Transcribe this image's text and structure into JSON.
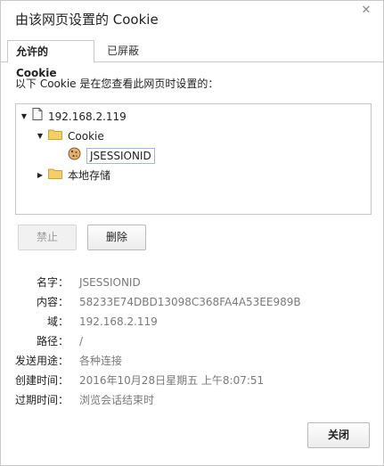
{
  "dialog": {
    "title": "由该网页设置的 Cookie",
    "close_glyph": "✕"
  },
  "tabs": [
    {
      "label": "允许的 Cookie"
    },
    {
      "label": "已屏蔽"
    }
  ],
  "intro": "以下 Cookie 是在您查看此网页时设置的：",
  "tree": {
    "host": "192.168.2.119",
    "folder_cookie": "Cookie",
    "cookie_item": "JSESSIONID",
    "folder_storage": "本地存储"
  },
  "buttons": {
    "block": "禁止",
    "delete": "删除",
    "close": "关闭"
  },
  "details": [
    {
      "label": "名字：",
      "value": "JSESSIONID"
    },
    {
      "label": "内容：",
      "value": "58233E74DBD13098C368FA4A53EE989B"
    },
    {
      "label": "域：",
      "value": "192.168.2.119"
    },
    {
      "label": "路径：",
      "value": "/"
    },
    {
      "label": "发送用途：",
      "value": "各种连接"
    },
    {
      "label": "创建时间：",
      "value": "2016年10月28日星期五 上午8:07:51"
    },
    {
      "label": "过期时间：",
      "value": "浏览会话结束时"
    }
  ],
  "icons": {
    "page": "page-icon",
    "folder": "folder-icon",
    "cookie": "cookie-icon"
  },
  "colors": {
    "folder": "#f3cf6b",
    "selection_border": "#9cb8da",
    "value_text": "#7a7a7a"
  }
}
